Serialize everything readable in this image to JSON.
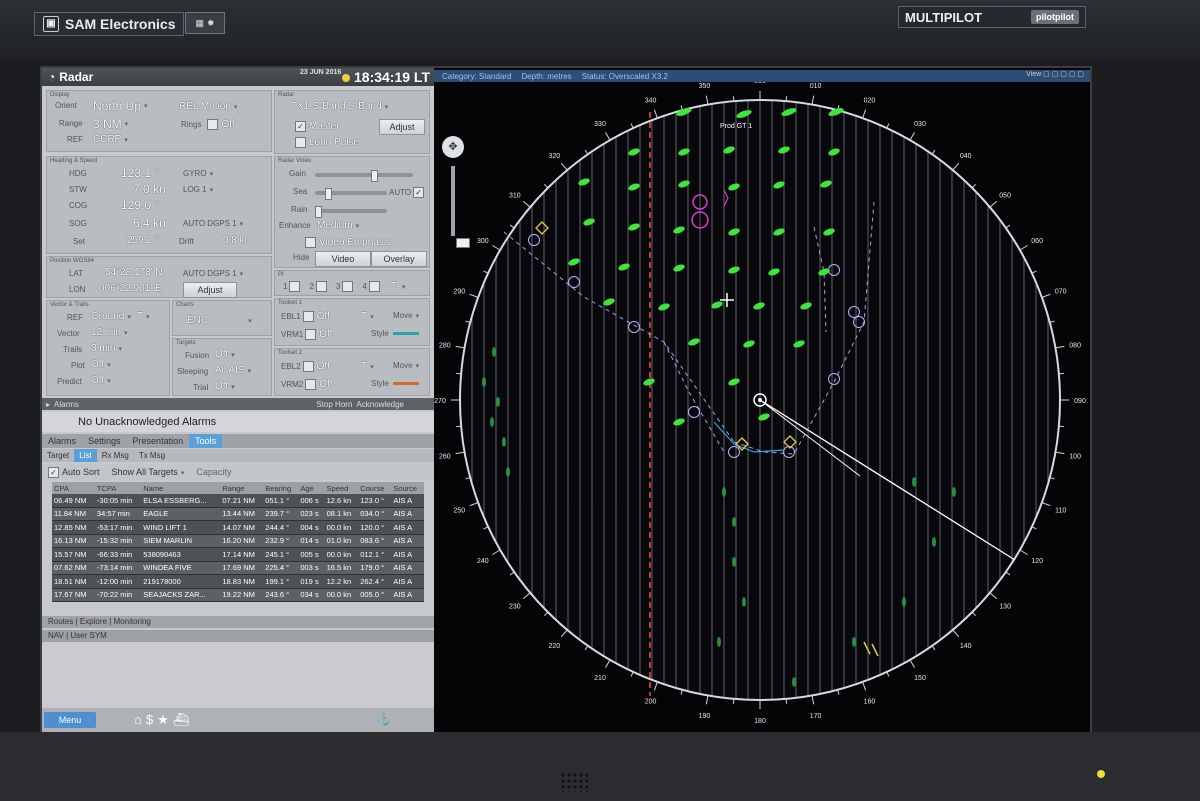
{
  "bezel": {
    "brand": "SAM Electronics",
    "multipilot": "MULTIPILOT",
    "multipilot_tag": "pilotpilot"
  },
  "window": {
    "title": "Radar",
    "date": "23 JUN 2016",
    "clock": "18:34:19 LT"
  },
  "display": {
    "section": "Display",
    "orient_label": "Orient",
    "orient": "North Up",
    "motion": "REL Motion",
    "range_label": "Range",
    "range": "3 NM",
    "rings_label": "Rings",
    "rings": "Off",
    "ref_label": "REF",
    "ref": "CCRP"
  },
  "radar": {
    "section": "Radar",
    "transceiver": "TX1 S-Band S-Band",
    "master": "Master",
    "adjust": "Adjust",
    "long_pulse": "Long Pulse"
  },
  "heading": {
    "section": "Heading & Speed",
    "hdg_label": "HDG",
    "hdg": "123.1 °",
    "hdg_src": "GYRO",
    "stw_label": "STW",
    "stw": "7.0 kn",
    "stw_src": "LOG 1",
    "cog_label": "COG",
    "cog": "129.0 °",
    "sog_label": "SOG",
    "sog": "6.4 kn",
    "sog_src": "AUTO DGPS 1",
    "set_label": "Set",
    "set": "259.2 °",
    "drift_label": "Drift",
    "drift": "0.8 kn"
  },
  "video": {
    "section": "Radar Video",
    "gain": "Gain",
    "sea": "Sea",
    "auto": "AUTO",
    "rain": "Rain",
    "enhance_label": "Enhance",
    "enhance": "Medium",
    "video_emphasis": "Video Emphasis",
    "hide_label": "Hide",
    "video_btn": "Video",
    "overlay_btn": "Overlay"
  },
  "position": {
    "section": "Position WGS84",
    "lat_label": "LAT",
    "lat": "54°28.173' N",
    "lat_src": "AUTO DGPS 1",
    "lon_label": "LON",
    "lon": "006°22.901' E",
    "adjust": "Adjust"
  },
  "pi": {
    "section": "PI",
    "p1": "1",
    "p2": "2",
    "p3": "3",
    "p4": "4",
    "t": "T"
  },
  "vector": {
    "section": "Vector & Trails",
    "ref_label": "REF",
    "ref": "Ground",
    "t": "T",
    "vector_label": "Vector",
    "vector": "12 min",
    "trails_label": "Trails",
    "trails": "3 min",
    "plot_label": "Plot",
    "plot": "Off",
    "predict_label": "Predict",
    "predict": "Off"
  },
  "charts": {
    "section": "Charts",
    "value": "ENC"
  },
  "targets": {
    "section": "Targets",
    "fusion_label": "Fusion",
    "fusion": "Off",
    "sleeping_label": "Sleeping",
    "sleeping": "All AIS",
    "trial_label": "Trial",
    "trial": "Off"
  },
  "toolset1": {
    "section": "Toolset 1",
    "ebl": "EBL1",
    "ebl_val": "Off",
    "t": "T",
    "move": "Move",
    "vrm": "VRM1",
    "vrm_val": "Off",
    "style": "Style"
  },
  "toolset2": {
    "section": "Toolset 2",
    "ebl": "EBL2",
    "ebl_val": "Off",
    "t": "T",
    "move": "Move",
    "vrm": "VRM2",
    "vrm_val": "Off",
    "style": "Style"
  },
  "alarms": {
    "section": "Alarms",
    "stop_horn": "Stop Horn",
    "acknowledge": "Acknowledge",
    "status": "No Unacknowledged Alarms"
  },
  "tabs": [
    "Alarms",
    "Settings",
    "Presentation",
    "Tools"
  ],
  "subtabs": [
    "Target",
    "List",
    "Rx Msg",
    "Tx Msg"
  ],
  "target_toolbar": {
    "auto_sort": "Auto Sort",
    "show_all": "Show All Targets",
    "capacity": "Capacity"
  },
  "target_table": {
    "headers": [
      "CPA",
      "TCPA",
      "Name",
      "Range",
      "Bearing",
      "Age",
      "Speed",
      "Course",
      "Source"
    ],
    "rows": [
      [
        "06.49 NM",
        "-30:05 min",
        "ELSA ESSBERG...",
        "07.21 NM",
        "051.1 °",
        "006 s",
        "12.6 kn",
        "123.0 °",
        "AIS A"
      ],
      [
        "11.84 NM",
        "34:57 min",
        "EAGLE",
        "13.44 NM",
        "239.7 °",
        "023 s",
        "08.1 kn",
        "034.0 °",
        "AIS A"
      ],
      [
        "12.85 NM",
        "-53:17 min",
        "WIND LIFT 1",
        "14.07 NM",
        "244.4 °",
        "004 s",
        "00.0 kn",
        "120.0 °",
        "AIS A"
      ],
      [
        "16.13 NM",
        "-15:32 min",
        "SIEM MARLIN",
        "16.20 NM",
        "232.9 °",
        "014 s",
        "01.0 kn",
        "083.6 °",
        "AIS A"
      ],
      [
        "15.57 NM",
        "-66:33 min",
        "538090463",
        "17.14 NM",
        "245.1 °",
        "005 s",
        "00.0 kn",
        "012.1 °",
        "AIS A"
      ],
      [
        "07.62 NM",
        "-73:14 min",
        "WINDEA FIVE",
        "17.69 NM",
        "225.4 °",
        "003 s",
        "16.5 kn",
        "179.0 °",
        "AIS A"
      ],
      [
        "18.51 NM",
        "-12:00 min",
        "219178000",
        "18.83 NM",
        "199.1 °",
        "019 s",
        "12.2 kn",
        "262.4 °",
        "AIS A"
      ],
      [
        "17.67 NM",
        "-70:22 min",
        "SEAJACKS ZAR...",
        "19.22 NM",
        "243.6 °",
        "034 s",
        "00.0 kn",
        "005.0 °",
        "AIS A"
      ]
    ]
  },
  "routes_bar": "Routes | Explore | Monitoring",
  "nav_bar": "NAV | User SYM",
  "footer": {
    "menu": "Menu"
  },
  "chart_bar": {
    "category_label": "Category:",
    "category": "Standard",
    "depth_label": "Depth:",
    "depth": "metres",
    "status_label": "Status:",
    "status": "Overscaled X3.2",
    "view": "View"
  },
  "radar_display": {
    "bearings": [
      "000",
      "010",
      "020",
      "030",
      "040",
      "050",
      "060",
      "070",
      "080",
      "090",
      "100",
      "110",
      "120",
      "130",
      "140",
      "150",
      "160",
      "170",
      "180",
      "190",
      "200",
      "210",
      "220",
      "230",
      "240",
      "250",
      "260",
      "270",
      "280",
      "290",
      "300",
      "310",
      "320",
      "330",
      "340",
      "350"
    ],
    "target_label": "Prod GT 1",
    "colors": {
      "echo": "#3fe53f",
      "ais": "#b6b4ff",
      "ring": "#d8d8e0",
      "ebl_red": "#ff4a3a",
      "magenta": "#d63ad0",
      "trail": "#35a8d8"
    }
  }
}
